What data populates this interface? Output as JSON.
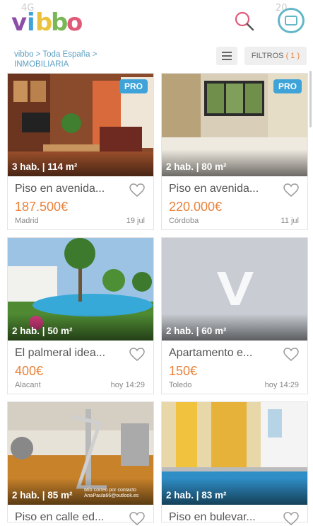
{
  "header": {
    "logo": "vibbo",
    "status_left": "4G",
    "status_right": "20"
  },
  "breadcrumb": {
    "home": "vibbo",
    "region": "Toda España",
    "category": "INMOBILIARIA"
  },
  "toolbar": {
    "filters_label": "FILTROS",
    "filters_count": "( 1 )"
  },
  "listings": [
    {
      "rooms": "3 hab. | 114 m²",
      "pro": "PRO",
      "title": "Piso en avenida...",
      "price": "187.500€",
      "location": "Madrid",
      "date": "19 jul"
    },
    {
      "rooms": "2 hab. | 80 m²",
      "pro": "PRO",
      "title": "Piso en avenida...",
      "price": "220.000€",
      "location": "Córdoba",
      "date": "11 jul"
    },
    {
      "rooms": "2 hab. | 50 m²",
      "pro": "",
      "title": "El palmeral idea...",
      "price": "400€",
      "location": "Alacant",
      "date": "hoy 14:29"
    },
    {
      "rooms": "2 hab. | 60 m²",
      "pro": "",
      "title": "Apartamento e...",
      "price": "150€",
      "location": "Toledo",
      "date": "hoy 14:29"
    },
    {
      "rooms": "2 hab. | 85 m²",
      "pro": "",
      "title": "Piso en calle ed...",
      "price": "",
      "location": "",
      "date": "",
      "watermark": "Mío correo por contacto AnaPaula66@outlook.es"
    },
    {
      "rooms": "2 hab. | 83 m²",
      "pro": "",
      "title": "Piso en bulevar...",
      "price": "",
      "location": "",
      "date": ""
    }
  ],
  "colors": {
    "accent_orange": "#e8823b",
    "link_blue": "#5b9fc2",
    "pro_badge": "#3ea3d8",
    "message_teal": "#63b7c8"
  }
}
